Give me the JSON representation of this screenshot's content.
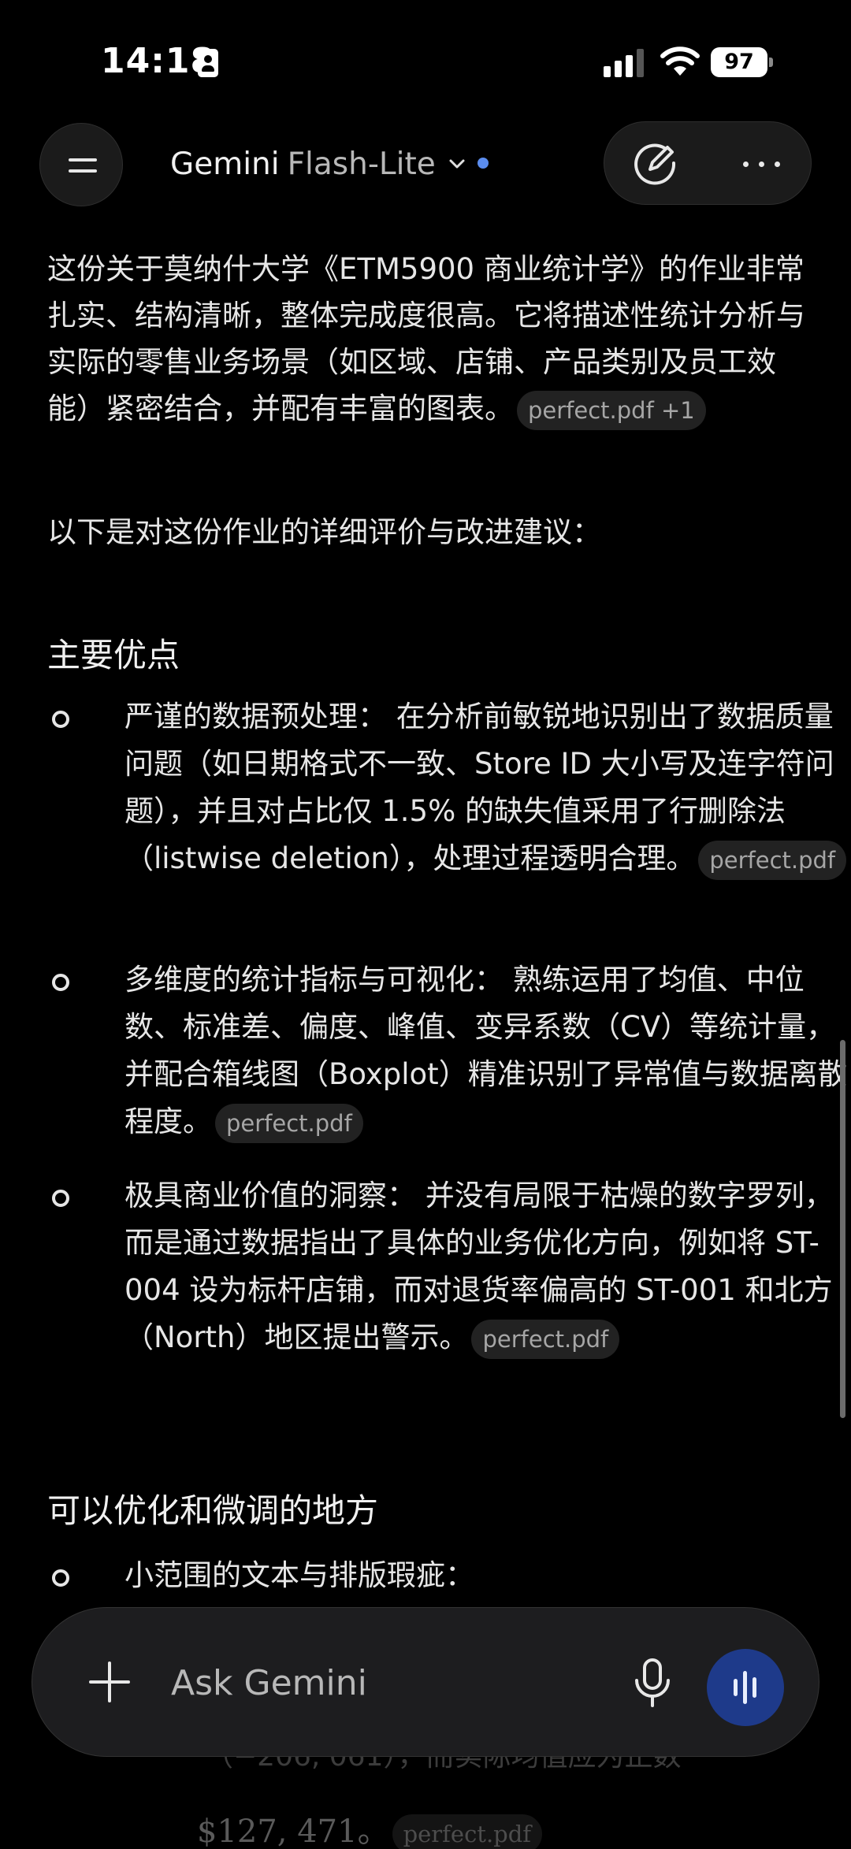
{
  "status_bar": {
    "time": "14:18",
    "battery": "97"
  },
  "header": {
    "brand": "Gemini",
    "model": "Flash-Lite",
    "icons": [
      "menu-icon",
      "chevron-down-icon",
      "edit-icon",
      "more-icon"
    ]
  },
  "content": {
    "intro": "这份关于莫纳什大学《ETM5900 商业统计学》的作业非常扎实、结构清晰，整体完成度很高。它将描述性统计分析与实际的零售业务场景（如区域、店铺、产品类别及员工效能）紧密结合，并配有丰富的图表。",
    "intro_chip": "perfect.pdf +1",
    "lead": "以下是对这份作业的详细评价与改进建议：",
    "section1_title": "主要优点",
    "bullets": [
      {
        "text": "严谨的数据预处理： 在分析前敏锐地识别出了数据质量问题（如日期格式不一致、Store ID 大小写及连字符问题），并且对占比仅 1.5% 的缺失值采用了行删除法（listwise deletion），处理过程透明合理。",
        "chip": "perfect.pdf"
      },
      {
        "text": "多维度的统计指标与可视化： 熟练运用了均值、中位数、标准差、偏度、峰值、变异系数（CV）等统计量，并配合箱线图（Boxplot）精准识别了异常值与数据离散程度。",
        "chip": "perfect.pdf"
      },
      {
        "text": "极具商业价值的洞察： 并没有局限于枯燥的数字罗列，而是通过数据指出了具体的业务优化方向，例如将 ST-004 设为标杆店铺，而对退货率偏高的 ST-001 和北方（North）地区提出警示。",
        "chip": "perfect.pdf"
      }
    ],
    "section2_title": "可以优化和微调的地方",
    "bullet4": "小范围的文本与排版瑕疵：",
    "faded_mid": "（−206, 061），而实际均值应为正数",
    "faded_value": "$127, 471。",
    "faded_chip": "perfect.pdf"
  },
  "input": {
    "placeholder": "Ask Gemini",
    "icons": [
      "plus-icon",
      "mic-icon",
      "voice-waveform-icon"
    ]
  },
  "colors": {
    "background": "#000000",
    "accent_blue": "#1e3a8a",
    "dot_blue": "#5b8def"
  }
}
